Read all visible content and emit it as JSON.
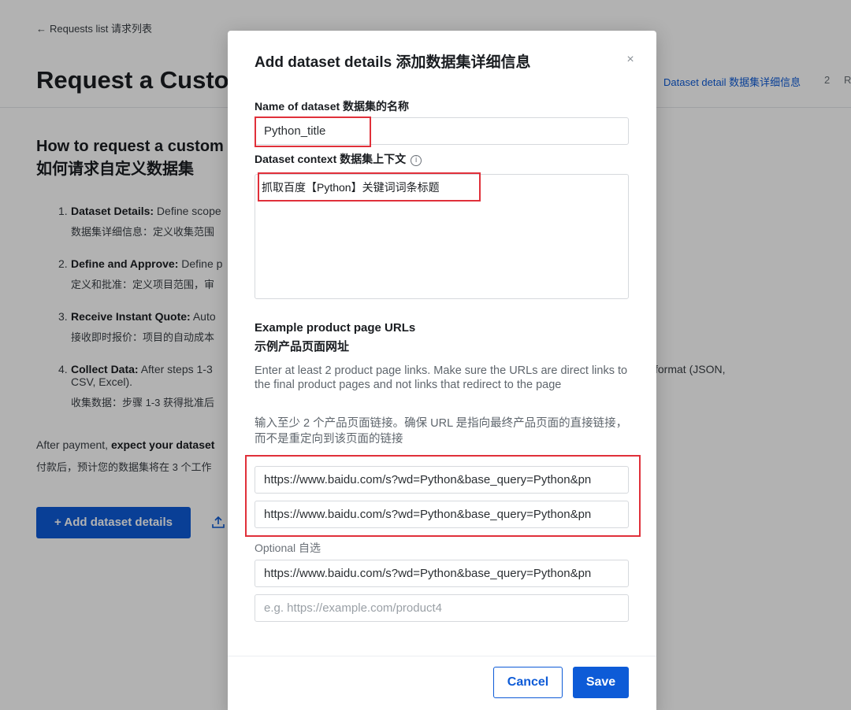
{
  "background": {
    "back_link": "Requests list 请求列表",
    "page_title": "Request a Custom Dataset",
    "stepper": {
      "step1_label": "Dataset detail 数据集详细信息",
      "step2_num": "2",
      "step2_label": "R"
    },
    "how_title_en": "How to request a custom dataset",
    "how_title_zh": "如何请求自定义数据集",
    "steps": [
      {
        "num": "1.",
        "label": "Dataset Details:",
        "text": " Define scope",
        "zh": "数据集详细信息：定义收集范围"
      },
      {
        "num": "2.",
        "label": "Define and Approve:",
        "text": " Define p",
        "zh": "定义和批准：定义项目范围，审"
      },
      {
        "num": "3.",
        "label": "Receive Instant Quote:",
        "text": " Auto",
        "zh": "接收即时报价：项目的自动成本"
      },
      {
        "num": "4.",
        "label": "Collect Data:",
        "text": " After steps 1-3",
        "text_line2": "CSV, Excel).",
        "zh": "收集数据：步骤 1-3 获得批准后",
        "text_right": "format (JSON,"
      }
    ],
    "after_payment_prefix": "After payment, ",
    "after_payment_bold": "expect your dataset",
    "after_payment_zh": "付款后，预计您的数据集将在 3 个工作",
    "add_button_label": "+ Add dataset details"
  },
  "modal": {
    "title": "Add dataset details 添加数据集详细信息",
    "close_symbol": "×",
    "name_label": "Name of dataset 数据集的名称",
    "name_value": "Python_title",
    "context_label": "Dataset context 数据集上下文",
    "info_symbol": "i",
    "context_value": "抓取百度【Python】关键词词条标题",
    "urls_label_en": "Example product page URLs",
    "urls_label_zh": "示例产品页面网址",
    "help_en": "Enter at least 2 product page links. Make sure the URLs are direct links to the final product pages and not links that redirect to the page",
    "help_zh": "输入至少 2 个产品页面链接。确保 URL 是指向最终产品页面的直接链接，而不是重定向到该页面的链接",
    "url_inputs": [
      "https://www.baidu.com/s?wd=Python&base_query=Python&pn",
      "https://www.baidu.com/s?wd=Python&base_query=Python&pn"
    ],
    "optional_label": "Optional 自选",
    "optional_inputs": [
      {
        "value": "https://www.baidu.com/s?wd=Python&base_query=Python&pn",
        "placeholder": ""
      },
      {
        "value": "",
        "placeholder": "e.g. https://example.com/product4"
      }
    ],
    "cancel_label": "Cancel",
    "save_label": "Save"
  },
  "colors": {
    "accent": "#0d5bd7",
    "highlight_box": "#e0303a",
    "overlay": "rgba(0,0,0,0.3)"
  },
  "icons": [
    "arrow-left-icon",
    "info-icon",
    "close-icon",
    "upload-icon",
    "plus-icon"
  ]
}
